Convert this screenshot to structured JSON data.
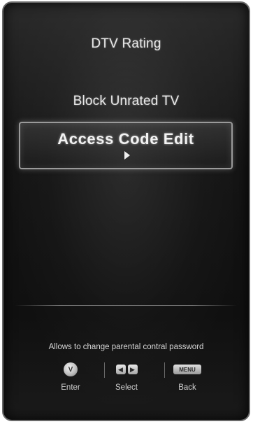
{
  "menu": {
    "items": [
      {
        "label": "DTV Rating"
      },
      {
        "label": "Block Unrated TV"
      },
      {
        "label": "Access Code Edit"
      }
    ],
    "selected_index": 2
  },
  "description": "Allows to change parental contral password",
  "controls": {
    "enter": {
      "label": "Enter",
      "key": "V",
      "icon": "v-button-icon"
    },
    "select": {
      "label": "Select",
      "keys": [
        "◀",
        "▶"
      ],
      "icon": "left-right-arrows-icon"
    },
    "back": {
      "label": "Back",
      "key": "MENU",
      "icon": "menu-button-icon"
    }
  },
  "colors": {
    "background": "#141414",
    "text": "#e8e8e8",
    "highlight_border": "#9a9a9a"
  }
}
